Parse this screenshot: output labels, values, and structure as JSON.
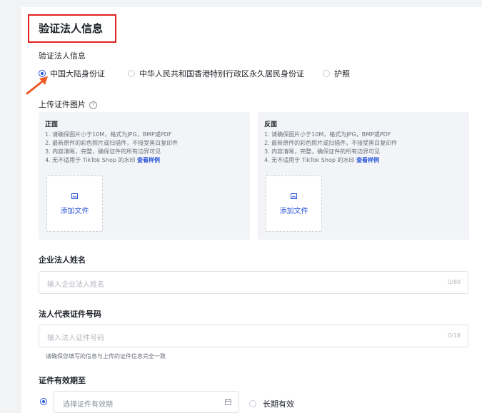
{
  "section": {
    "title": "验证法人信息",
    "id_type_label": "验证法人信息",
    "id_type_options": [
      {
        "label": "中国大陆身份证",
        "checked": true
      },
      {
        "label": "中华人民共和国香港特别行政区永久居民身份证",
        "checked": false
      },
      {
        "label": "护照",
        "checked": false
      }
    ]
  },
  "upload": {
    "label": "上传证件图片",
    "help_glyph": "?",
    "front": {
      "title": "正面",
      "rules": [
        "1. 请确保图片小于10M，格式为JPG，BMP或PDF",
        "2. 最新原件的彩色照片或扫描件，不接受黑白复印件",
        "3. 内容清晰，完整，确保证件的所有边界可见",
        "4. 无不适用于 TikTok Shop 的水印"
      ],
      "example_link": "查看样例",
      "add_file": "添加文件"
    },
    "back": {
      "title": "反面",
      "rules": [
        "1. 请确保图片小于10M，格式为JPG，BMP或PDF",
        "2. 最新原件的彩色照片或扫描件，不接受黑白复印件",
        "3. 内容清晰，完整，确保证件的所有边界可见",
        "4. 无不适用于 TikTok Shop 的水印"
      ],
      "example_link": "查看样例",
      "add_file": "添加文件"
    }
  },
  "legal_name": {
    "label": "企业法人姓名",
    "placeholder": "输入企业法人姓名",
    "counter": "0/80"
  },
  "id_number": {
    "label": "法人代表证件号码",
    "placeholder": "输入法人证件号码",
    "counter": "0/18",
    "hint": "请确保您填写的信息与上传的证件信息完全一致"
  },
  "validity": {
    "label": "证件有效期至",
    "date_placeholder": "选择证件有效期",
    "long_term": "长期有效"
  },
  "colors": {
    "accent": "#2b55d9",
    "highlight_box": "#e02020",
    "arrow": "#f05a28"
  }
}
